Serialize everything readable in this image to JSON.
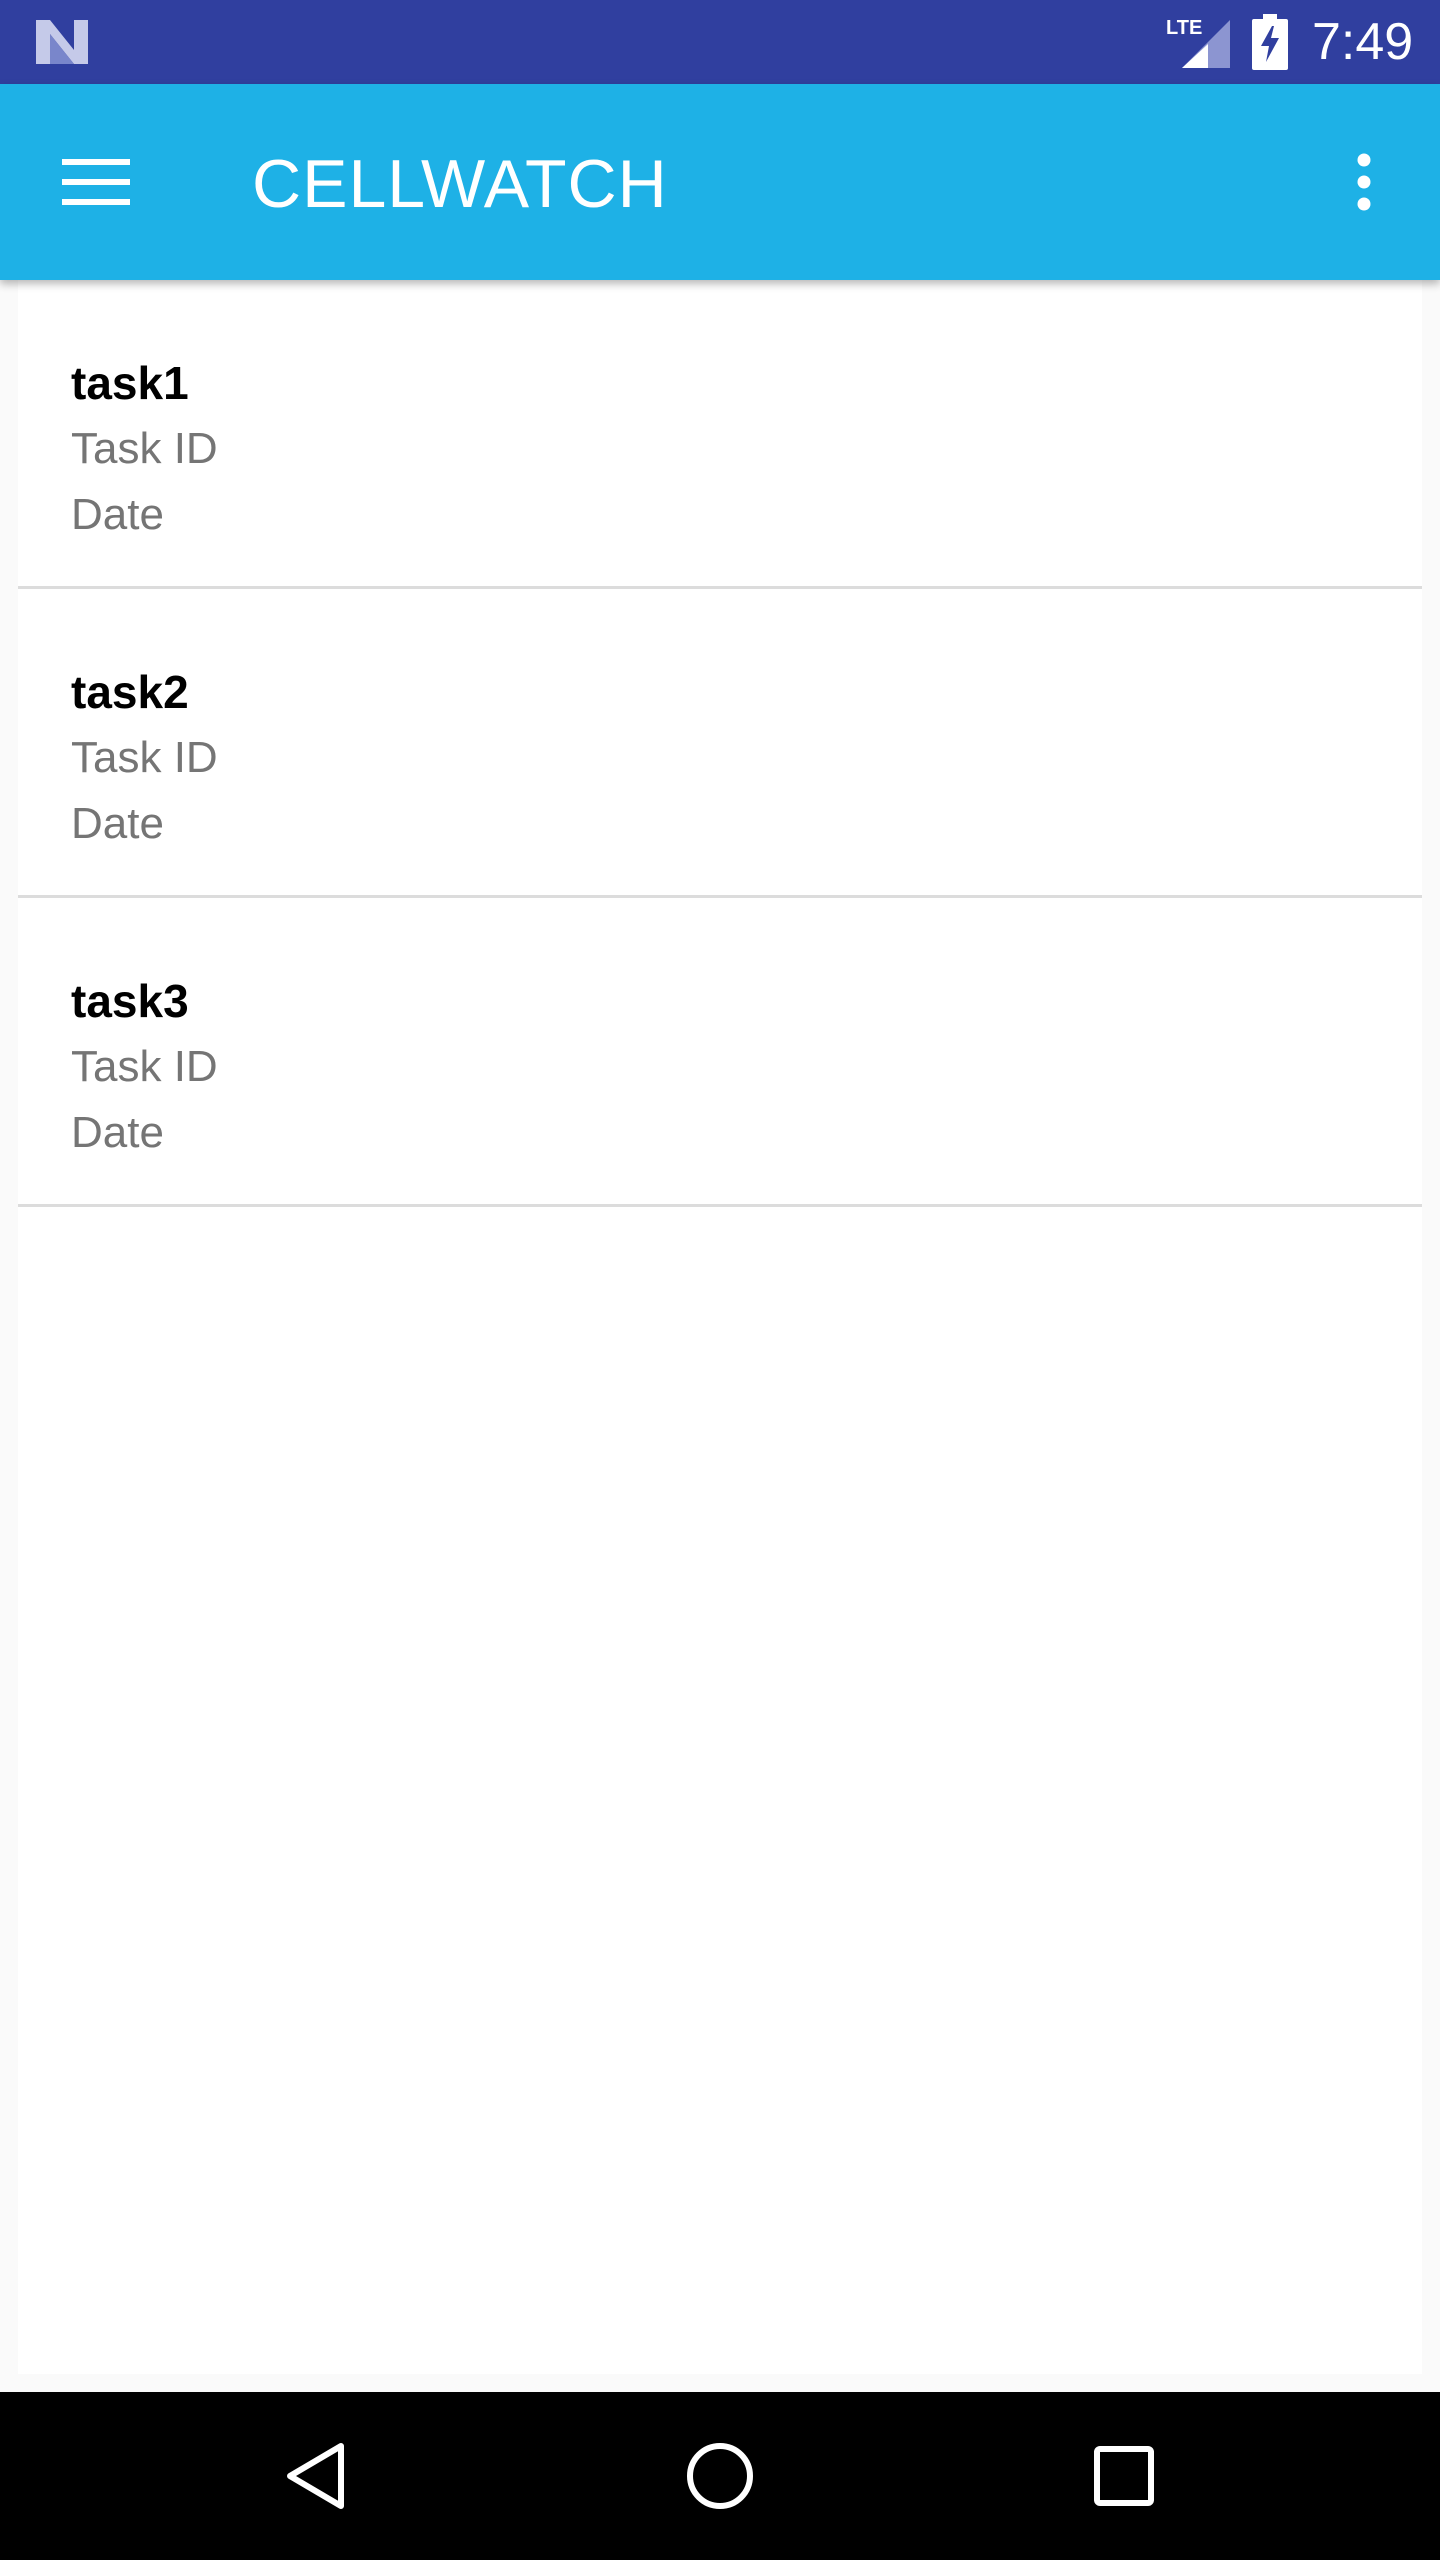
{
  "status_bar": {
    "time": "7:49",
    "network_label": "LTE",
    "notification_icon": "n-logo-icon",
    "signal_icon": "signal-icon",
    "battery_icon": "battery-charging-icon"
  },
  "app_bar": {
    "title": "CELLWATCH",
    "menu_icon": "hamburger-menu-icon",
    "overflow_icon": "more-vert-icon",
    "background_color": "#1eb1e6"
  },
  "tasks": [
    {
      "name": "task1",
      "id_label": "Task ID",
      "date_label": "Date"
    },
    {
      "name": "task2",
      "id_label": "Task ID",
      "date_label": "Date"
    },
    {
      "name": "task3",
      "id_label": "Task ID",
      "date_label": "Date"
    }
  ],
  "nav_bar": {
    "back_icon": "back-triangle-icon",
    "home_icon": "home-circle-icon",
    "recents_icon": "recents-square-icon"
  },
  "colors": {
    "status_bar": "#303f9f",
    "app_bar": "#1eb1e6",
    "secondary_text": "#757575",
    "divider": "#dcdcdc"
  }
}
